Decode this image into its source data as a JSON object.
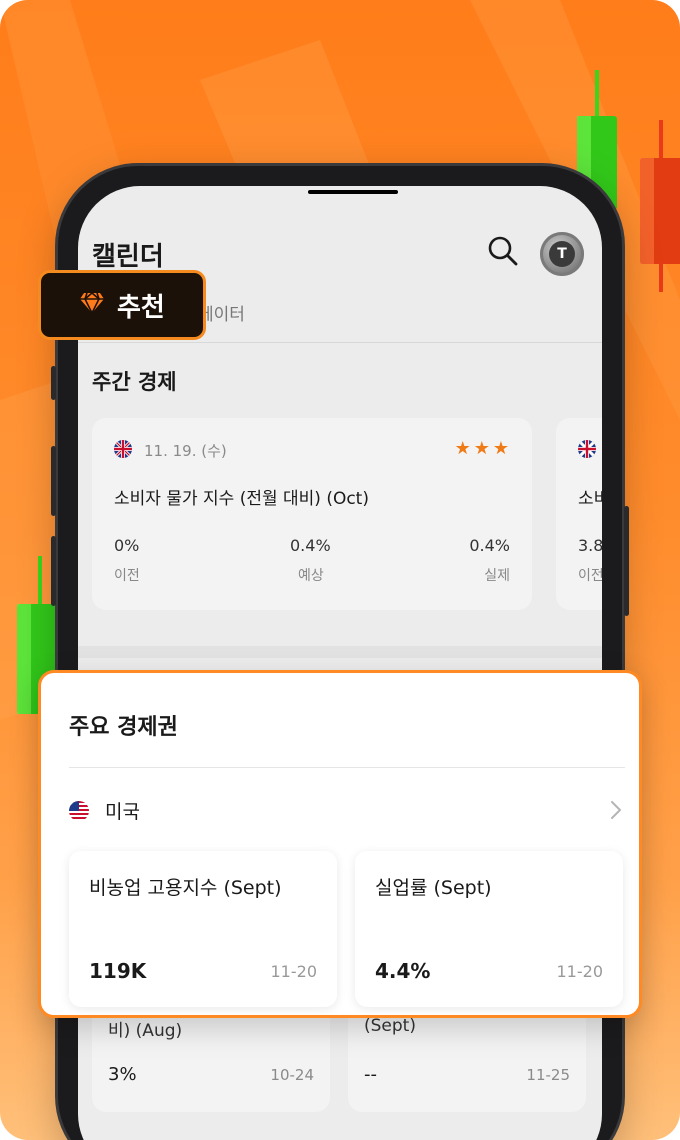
{
  "colors": {
    "accent": "#f07a16",
    "badge_border": "#f58a1f",
    "panel_border": "#ff8a24",
    "candle_green": "#3ad61e",
    "candle_red": "#e93a1a"
  },
  "header": {
    "title": "캘린더",
    "search_icon": "search-icon",
    "avatar_icon": "avatar-icon"
  },
  "tabs": {
    "partial_label": "데이터"
  },
  "recommend": {
    "icon": "diamond-icon",
    "label": "추천"
  },
  "weekly": {
    "title": "주간 경제",
    "cards": [
      {
        "flag": "uk-flag-icon",
        "date": "11. 19. (수)",
        "stars": "★★★",
        "title": "소비자 물가 지수 (전월 대비) (Oct)",
        "prev_value": "0%",
        "prev_label": "이전",
        "forecast_value": "0.4%",
        "forecast_label": "예상",
        "actual_value": "0.4%",
        "actual_label": "실제"
      },
      {
        "flag": "uk-flag-icon",
        "title_partial": "소비",
        "prev_value_partial": "3.8",
        "prev_label_partial": "이전"
      }
    ]
  },
  "bottom_cards": [
    {
      "title_partial": "비) (Aug)",
      "value": "3%",
      "date": "10-24"
    },
    {
      "title_partial": "(Sept)",
      "value": "--",
      "date": "11-25"
    }
  ],
  "panel": {
    "title": "주요 경제권",
    "region": {
      "flag": "us-flag-icon",
      "label": "미국",
      "chevron": "chevron-right-icon"
    },
    "indicators": [
      {
        "title": "비농업 고용지수 (Sept)",
        "value": "119K",
        "date": "11-20"
      },
      {
        "title": "실업률 (Sept)",
        "value": "4.4%",
        "date": "11-20"
      }
    ]
  }
}
